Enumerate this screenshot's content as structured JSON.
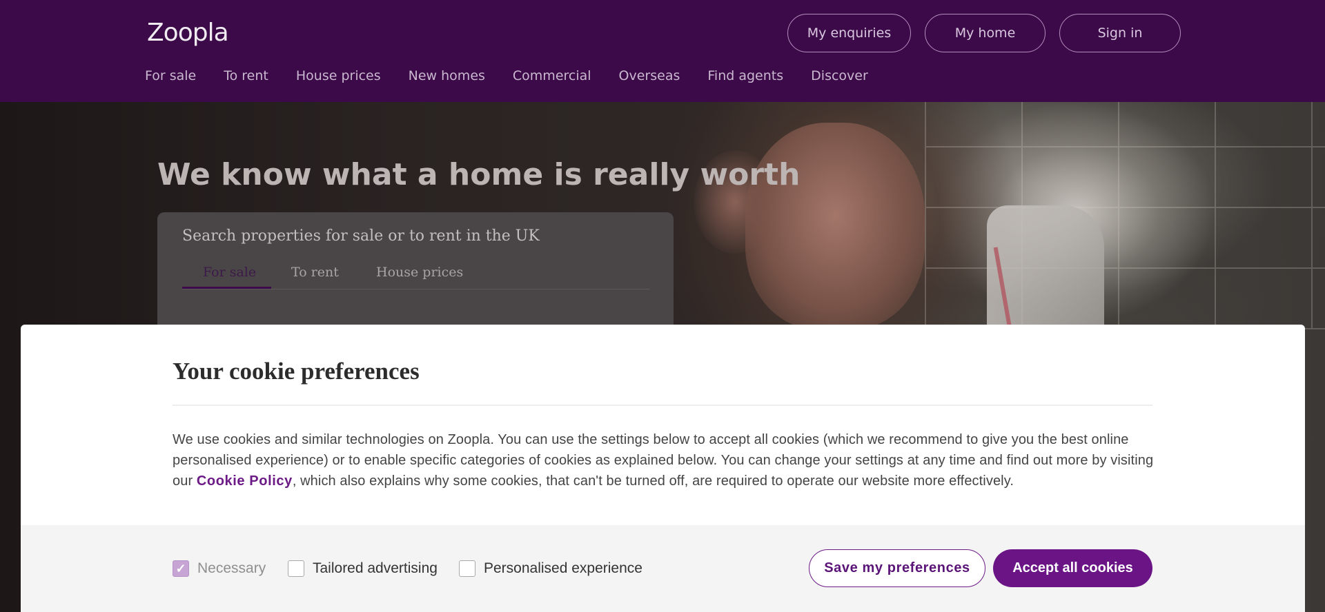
{
  "header": {
    "logo": "Zoopla",
    "buttons": {
      "enquiries": "My enquiries",
      "home": "My home",
      "sign_in": "Sign in"
    },
    "nav": [
      "For sale",
      "To rent",
      "House prices",
      "New homes",
      "Commercial",
      "Overseas",
      "Find agents",
      "Discover"
    ]
  },
  "hero": {
    "title": "We know what a home is really worth",
    "search": {
      "heading": "Search properties for sale or to rent in the UK",
      "tabs": [
        "For sale",
        "To rent",
        "House prices"
      ],
      "active_tab": "For sale"
    }
  },
  "cookie": {
    "title": "Your cookie preferences",
    "text_before_link": "We use cookies and similar technologies on Zoopla. You can use the settings below to accept all cookies (which we recommend to give you the best online personalised experience) or to enable specific categories of cookies as explained below. You can change your settings at any time and find out more by visiting our ",
    "link": "Cookie Policy",
    "text_after_link": ", which also explains why some cookies, that can't be turned off, are required to operate our website more effectively.",
    "options": [
      {
        "label": "Necessary",
        "checked": true,
        "disabled": true
      },
      {
        "label": "Tailored advertising",
        "checked": false,
        "disabled": false
      },
      {
        "label": "Personalised experience",
        "checked": false,
        "disabled": false
      }
    ],
    "save_button": "Save my preferences",
    "accept_button": "Accept all cookies"
  },
  "colors": {
    "brand_purple": "#3c0a49",
    "accent_purple": "#6a1486"
  }
}
